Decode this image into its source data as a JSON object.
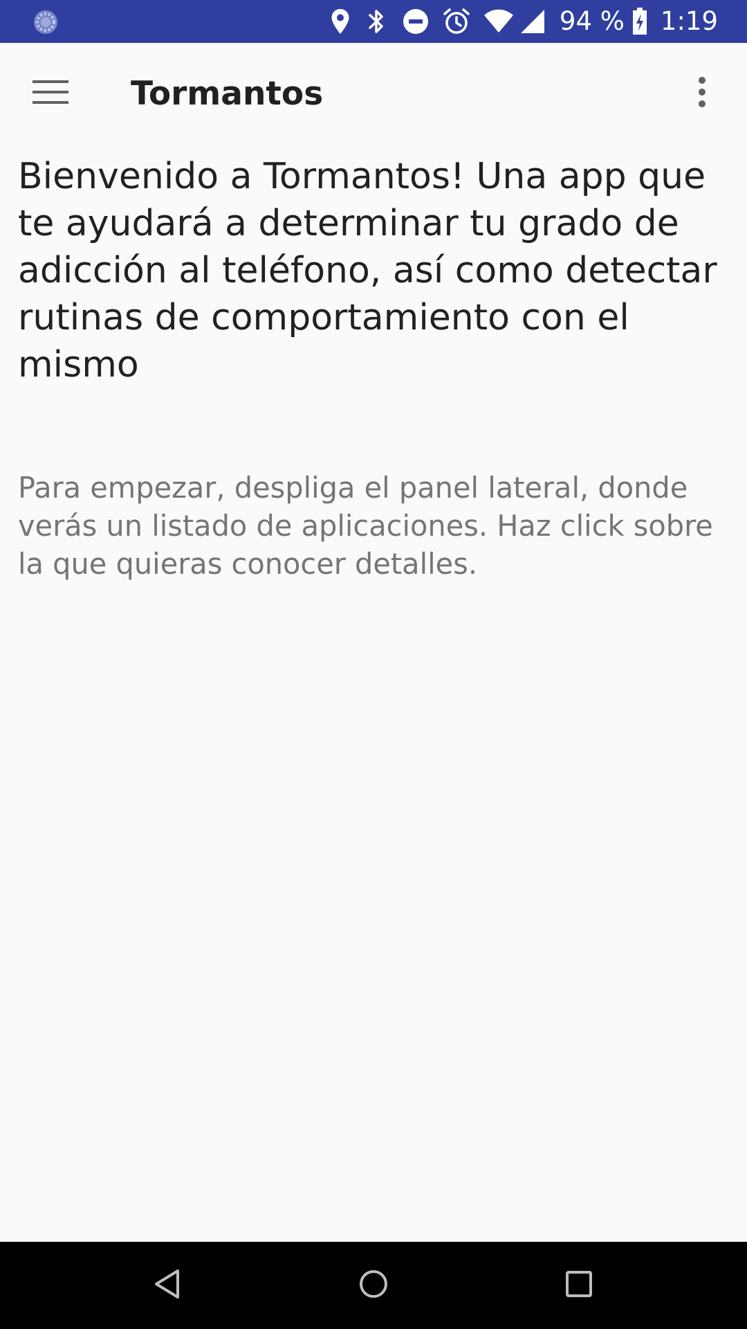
{
  "status_bar": {
    "battery_text": "94 %",
    "time": "1:19",
    "icons": [
      "sync-icon",
      "location-icon",
      "bluetooth-icon",
      "do-not-disturb-icon",
      "alarm-icon",
      "wifi-icon",
      "cellular-signal-icon",
      "battery-charging-icon"
    ],
    "background_color": "#303f9f"
  },
  "app_bar": {
    "title": "Tormantos",
    "left_icon": "menu-icon",
    "right_icon": "more-vert-icon"
  },
  "main": {
    "welcome": "Bienvenido a Tormantos! Una app que te ayudará a determinar tu grado de adicción al teléfono, así como detectar rutinas de comportamiento con el mismo",
    "instructions": "Para empezar, despliga el panel lateral, donde verás un listado de aplicaciones. Haz click sobre la que quieras conocer detalles."
  },
  "nav_bar": {
    "icons": [
      "back-icon",
      "home-icon",
      "recents-icon"
    ]
  }
}
